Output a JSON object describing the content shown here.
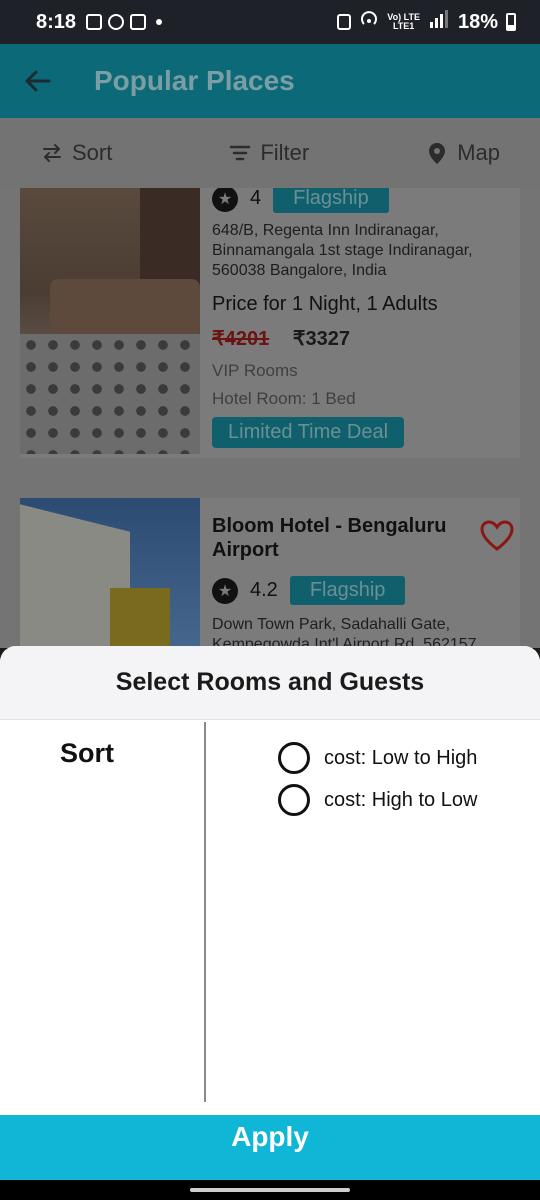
{
  "status_bar": {
    "time": "8:18",
    "network_top": "Vo) LTE",
    "network_bottom": "LTE1",
    "battery": "18%"
  },
  "app_bar": {
    "title": "Popular Places",
    "back_icon": "arrow-left-icon"
  },
  "toolbar": {
    "sort": "Sort",
    "filter": "Filter",
    "map": "Map"
  },
  "listings": [
    {
      "rating": "4",
      "badge": "Flagship",
      "address": "648/B, Regenta Inn Indiranagar, Binnamangala 1st stage Indiranagar, 560038 Bangalore, India",
      "price_title": "Price for 1 Night, 1 Adults",
      "old_price": "₹4201",
      "new_price": "₹3327",
      "room_type": "VIP Rooms",
      "beds": "Hotel Room: 1 Bed",
      "deal": "Limited Time Deal"
    },
    {
      "name": "Bloom Hotel - Bengaluru Airport",
      "rating": "4.2",
      "badge": "Flagship",
      "address": "Down Town Park, Sadahalli Gate, Kempegowda Int'l Airport Rd, 562157"
    }
  ],
  "sheet": {
    "title": "Select Rooms and Guests",
    "left_options": [
      "Sort"
    ],
    "sort_options": [
      "cost: Low to High",
      "cost: High to Low"
    ],
    "apply": "Apply"
  },
  "colors": {
    "accent": "#0fb6d5",
    "app_bar": "#0c6a78",
    "heart": "#8b1616"
  }
}
